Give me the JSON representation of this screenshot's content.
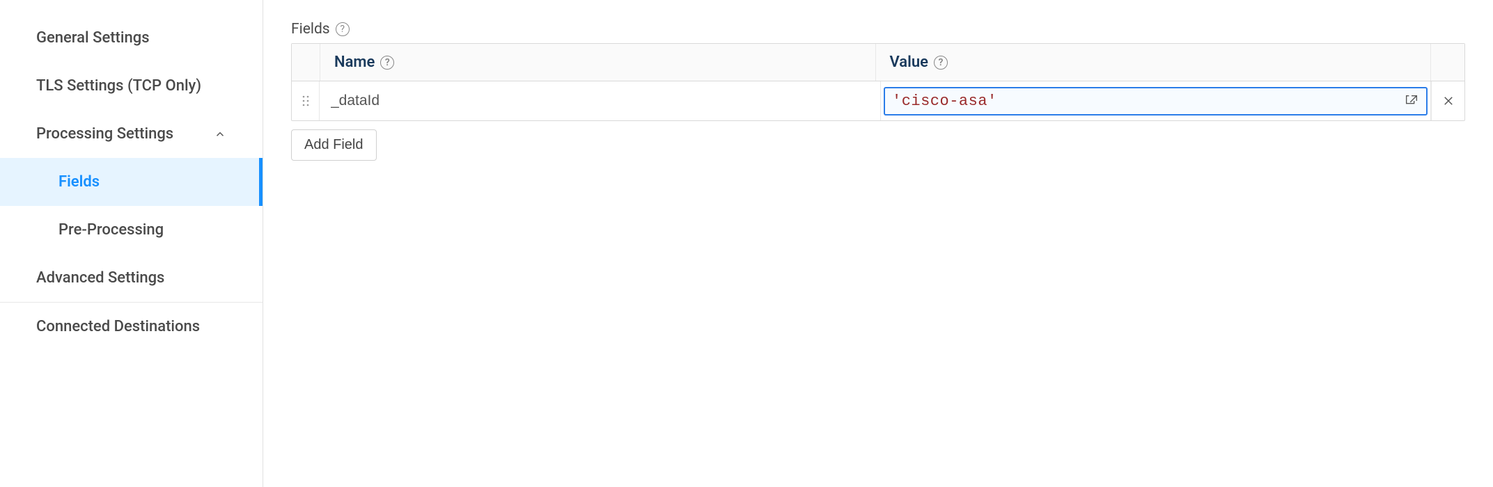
{
  "sidebar": {
    "items": [
      {
        "label": "General Settings",
        "expandable": false,
        "indented": false,
        "active": false
      },
      {
        "label": "TLS Settings (TCP Only)",
        "expandable": false,
        "indented": false,
        "active": false
      },
      {
        "label": "Processing Settings",
        "expandable": true,
        "expanded": true,
        "indented": false,
        "active": false
      },
      {
        "label": "Fields",
        "expandable": false,
        "indented": true,
        "active": true
      },
      {
        "label": "Pre-Processing",
        "expandable": false,
        "indented": true,
        "active": false
      },
      {
        "label": "Advanced Settings",
        "expandable": false,
        "indented": false,
        "active": false
      },
      {
        "label": "Connected Destinations",
        "expandable": false,
        "indented": false,
        "active": false
      }
    ]
  },
  "main": {
    "section_label": "Fields",
    "columns": {
      "name": "Name",
      "value": "Value"
    },
    "rows": [
      {
        "name": "_dataId",
        "value": "'cisco-asa'"
      }
    ],
    "add_button": "Add Field"
  }
}
